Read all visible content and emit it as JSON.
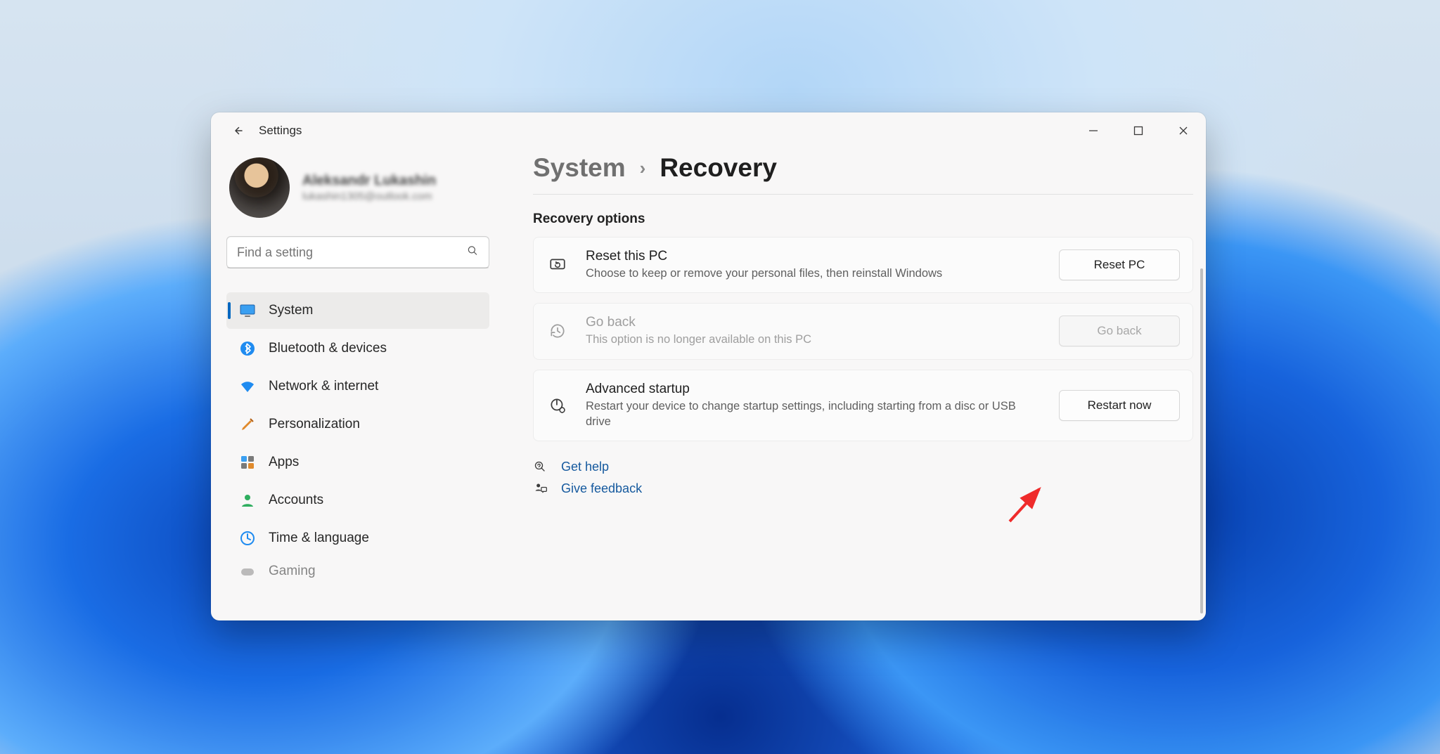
{
  "app": {
    "title": "Settings"
  },
  "profile": {
    "name": "Aleksandr Lukashin",
    "email": "lukashin1305@outlook.com"
  },
  "search": {
    "placeholder": "Find a setting"
  },
  "nav": {
    "items": [
      {
        "label": "System"
      },
      {
        "label": "Bluetooth & devices"
      },
      {
        "label": "Network & internet"
      },
      {
        "label": "Personalization"
      },
      {
        "label": "Apps"
      },
      {
        "label": "Accounts"
      },
      {
        "label": "Time & language"
      },
      {
        "label": "Gaming"
      }
    ]
  },
  "breadcrumb": {
    "root": "System",
    "page": "Recovery"
  },
  "section": {
    "title": "Recovery options"
  },
  "cards": {
    "reset": {
      "title": "Reset this PC",
      "sub": "Choose to keep or remove your personal files, then reinstall Windows",
      "button": "Reset PC"
    },
    "goback": {
      "title": "Go back",
      "sub": "This option is no longer available on this PC",
      "button": "Go back"
    },
    "advanced": {
      "title": "Advanced startup",
      "sub": "Restart your device to change startup settings, including starting from a disc or USB drive",
      "button": "Restart now"
    }
  },
  "help": {
    "get_help": "Get help",
    "feedback": "Give feedback"
  }
}
